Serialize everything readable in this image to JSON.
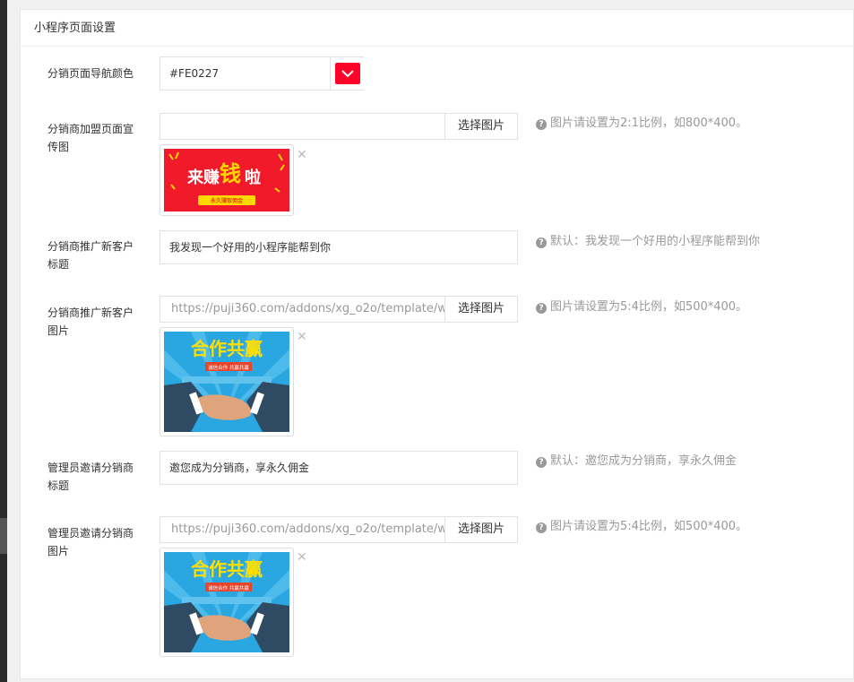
{
  "panel": {
    "title": "小程序页面设置"
  },
  "nav_color": {
    "label": "分销页面导航颜色",
    "value": "#FE0227",
    "swatch_color": "#FE0227"
  },
  "join_banner": {
    "label": "分销商加盟页面宣传图",
    "url": "",
    "button": "选择图片",
    "hint": "图片请设置为2:1比例，如800*400。",
    "image_text": {
      "main_a": "来赚",
      "main_b": "钱",
      "main_c": "啦",
      "sub": "永久赚取佣金"
    }
  },
  "promo_title": {
    "label": "分销商推广新客户标题",
    "value": "我发现一个好用的小程序能帮到你",
    "hint": "默认：我发现一个好用的小程序能帮到你"
  },
  "promo_image": {
    "label": "分销商推广新客户图片",
    "url": "https://puji360.com/addons/xg_o2o/template/we",
    "button": "选择图片",
    "hint": "图片请设置为5:4比例，如500*400。",
    "image_text": {
      "title": "合作共赢",
      "ribbon": "诚信合作 共赢共赢"
    }
  },
  "invite_title": {
    "label": "管理员邀请分销商标题",
    "value": "邀您成为分销商，享永久佣金",
    "hint": "默认：邀您成为分销商，享永久佣金"
  },
  "invite_image": {
    "label": "管理员邀请分销商图片",
    "url": "https://puji360.com/addons/xg_o2o/template/we",
    "button": "选择图片",
    "hint": "图片请设置为5:4比例，如500*400。",
    "image_text": {
      "title": "合作共赢",
      "ribbon": "诚信合作 共赢共赢"
    }
  },
  "icons": {
    "help": "question-circle-icon",
    "remove": "close-icon",
    "dropdown": "chevron-down-icon"
  }
}
